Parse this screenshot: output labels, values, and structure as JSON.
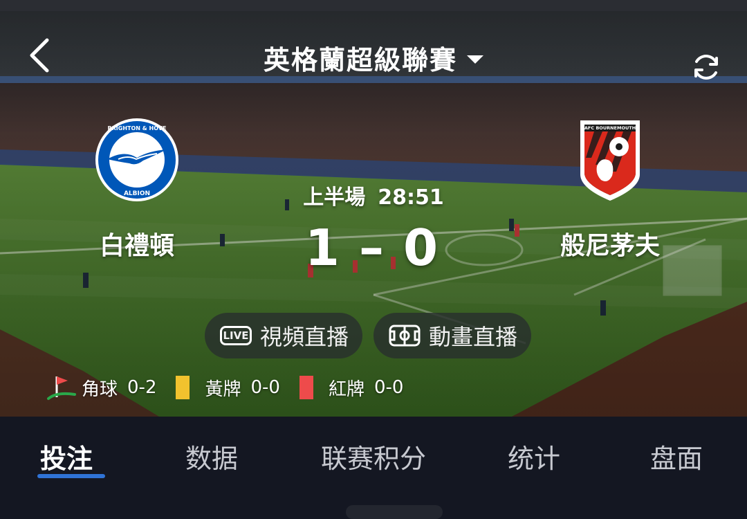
{
  "header": {
    "title": "英格蘭超級聯賽"
  },
  "match": {
    "home": {
      "name": "白禮頓",
      "crest_text": [
        "BRIGHTON & HOVE",
        "ALBION"
      ],
      "color": "#0057b8"
    },
    "away": {
      "name": "般尼茅夫",
      "crest_text": "AFC BOURNEMOUTH",
      "color": "#da291c"
    },
    "period": "上半場",
    "clock": "28:51",
    "score_home": "1",
    "score_sep": "–",
    "score_away": "0"
  },
  "buttons": {
    "video_live": "視頻直播",
    "live_badge": "LIVE",
    "animation_live": "動畫直播"
  },
  "stats": {
    "corners_label": "角球",
    "corners_value": "0-2",
    "yellow_label": "黃牌",
    "yellow_value": "0-0",
    "red_label": "紅牌",
    "red_value": "0-0"
  },
  "tabs": [
    {
      "label": "投注",
      "active": true
    },
    {
      "label": "数据"
    },
    {
      "label": "联赛积分"
    },
    {
      "label": "统计"
    },
    {
      "label": "盘面"
    }
  ],
  "colors": {
    "accent": "#2f73d6",
    "yellow_card": "#f2c22e",
    "red_card": "#ee4b4b",
    "pitch": "#3f6a26"
  },
  "icons": [
    "back-arrow-icon",
    "dropdown-caret-icon",
    "refresh-icon",
    "live-tv-icon",
    "pitch-icon",
    "corner-flag-icon",
    "yellow-card-icon",
    "red-card-icon"
  ]
}
